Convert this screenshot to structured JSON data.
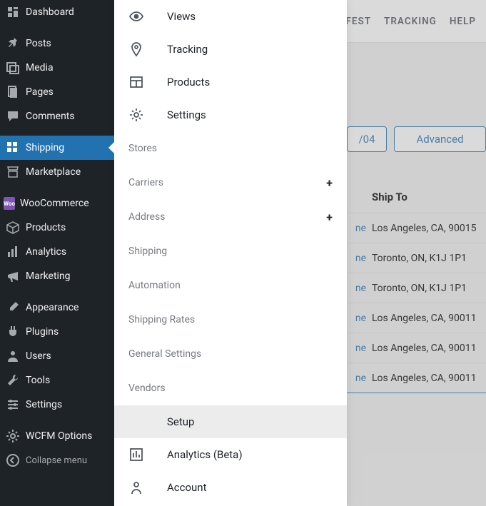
{
  "wp_sidebar": {
    "items": [
      {
        "label": "Dashboard",
        "icon": "dashboard",
        "classes": "sep-after"
      },
      {
        "label": "Posts",
        "icon": "pin"
      },
      {
        "label": "Media",
        "icon": "media"
      },
      {
        "label": "Pages",
        "icon": "pages"
      },
      {
        "label": "Comments",
        "icon": "comments",
        "classes": "sep-after"
      },
      {
        "label": "Shipping",
        "icon": "grid",
        "active": true
      },
      {
        "label": "Marketplace",
        "icon": "store",
        "classes": "sep-after"
      },
      {
        "label": "WooCommerce",
        "icon": "woo"
      },
      {
        "label": "Products",
        "icon": "box"
      },
      {
        "label": "Analytics",
        "icon": "bars"
      },
      {
        "label": "Marketing",
        "icon": "megaphone",
        "classes": "sep-after"
      },
      {
        "label": "Appearance",
        "icon": "brush"
      },
      {
        "label": "Plugins",
        "icon": "plug"
      },
      {
        "label": "Users",
        "icon": "user"
      },
      {
        "label": "Tools",
        "icon": "wrench"
      },
      {
        "label": "Settings",
        "icon": "sliders",
        "classes": "sep-after"
      },
      {
        "label": "WCFM Options",
        "icon": "gear"
      }
    ],
    "collapse": "Collapse menu"
  },
  "submenu": {
    "primary": [
      {
        "label": "Views",
        "icon": "eye"
      },
      {
        "label": "Tracking",
        "icon": "pin-circle"
      },
      {
        "label": "Products",
        "icon": "layout"
      },
      {
        "label": "Settings",
        "icon": "gear"
      }
    ],
    "sections": [
      {
        "label": "Stores"
      },
      {
        "label": "Carriers",
        "expandable": true
      },
      {
        "label": "Address",
        "expandable": true
      },
      {
        "label": "Shipping"
      },
      {
        "label": "Automation"
      },
      {
        "label": "Shipping Rates"
      },
      {
        "label": "General Settings"
      },
      {
        "label": "Vendors"
      }
    ],
    "selected": "Setup",
    "footer": [
      {
        "label": "Analytics (Beta)",
        "icon": "chart"
      },
      {
        "label": "Account",
        "icon": "person"
      }
    ]
  },
  "topnav": [
    "FEST",
    "TRACKING",
    "HELP"
  ],
  "filters": {
    "date": "/04",
    "advanced": "Advanced"
  },
  "table": {
    "header_ship": "Ship To",
    "rows": [
      {
        "ne": "ne",
        "ship": "Los Angeles, CA, 90015"
      },
      {
        "ne": "ne",
        "ship": "Toronto, ON, K1J 1P1"
      },
      {
        "ne": "ne",
        "ship": "Toronto, ON, K1J 1P1"
      },
      {
        "ne": "ne",
        "ship": "Los Angeles, CA, 90011"
      },
      {
        "ne": "ne",
        "ship": "Los Angeles, CA, 90011"
      },
      {
        "ne": "ne",
        "ship": "Los Angeles, CA, 90011"
      }
    ]
  }
}
